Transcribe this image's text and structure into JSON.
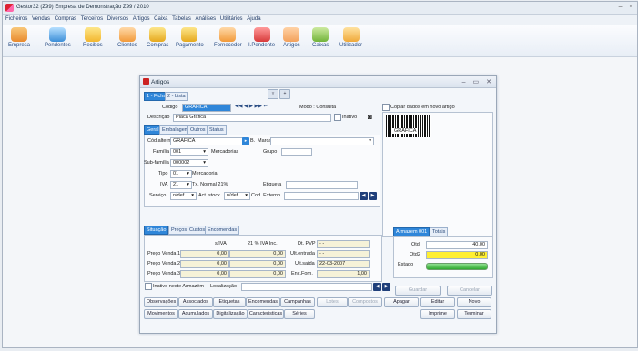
{
  "window": {
    "title": "Gestor32 (Z99) Empresa de Demonstração Z99 / 2010"
  },
  "menu": [
    "Ficheiros",
    "Vendas",
    "Compras",
    "Terceiros",
    "Diversos",
    "Artigos",
    "Caixa",
    "Tabelas",
    "Análises",
    "Utilitários",
    "Ajuda"
  ],
  "toolbar": [
    "Empresa",
    "Pendentes",
    "Recibos",
    "Clientes",
    "Compras",
    "Pagamento",
    "Fornecedor",
    "I.Pendente",
    "Artigos",
    "Caixas",
    "Utilizador"
  ],
  "dialog": {
    "title": "Artigos",
    "top_tabs": [
      "1 - Ficha",
      "2 - Lista"
    ],
    "codigo_label": "Código",
    "codigo": "GRÁFICA",
    "modo": "Modo : Consulta",
    "copiar": "Copiar dados em novo artigo",
    "descricao_label": "Descrição",
    "descricao": "Placa Gráfica",
    "inativo_label": "Inativo",
    "sub_tabs": [
      "Geral",
      "Embalagem",
      "Outros",
      "Status"
    ],
    "cod_altern_label": "Cód.altern",
    "cod_altern": "GRÁFICA",
    "marca_label": "Marca",
    "familia_label": "Família",
    "familia": "001",
    "familia_desc": "Mercadorias",
    "grupo_label": "Grupo",
    "subfamilia_label": "Sub-família",
    "subfamilia": "000002",
    "tipo_label": "Tipo",
    "tipo": "01",
    "tipo_desc": "Mercadoria",
    "iva_label": "IVA",
    "iva": "21",
    "iva_desc": "Tx. Normal 21%",
    "etiqueta_label": "Etiqueta",
    "servico_label": "Serviço",
    "servico": "n/def",
    "actstock_label": "Act. stock",
    "actstock": "n/def",
    "codexterno_label": "Cod. Externo",
    "barcode_text": "GRÁFICA",
    "bottom_tabs": [
      "Situação",
      "Preços",
      "Custos",
      "Encomendas"
    ],
    "col_siva": "s/IVA",
    "col_iva": "21 % IVA Inc.",
    "precos": [
      {
        "label": "Preço Venda 1",
        "siva": "0,00",
        "iva": "0,00"
      },
      {
        "label": "Preço Venda 2",
        "siva": "0,00",
        "iva": "0,00"
      },
      {
        "label": "Preço Venda 3",
        "siva": "0,00",
        "iva": "0,00"
      }
    ],
    "dtpvp_label": "Dt. PVP",
    "dtpvp": "- -",
    "ultentrada_label": "Ult.entrada",
    "ultentrada": "- -",
    "ultsaida_label": "Ult.saída",
    "ultsaida": "22-03-2007",
    "encforn_label": "Enc.Forn.",
    "encforn": "1,00",
    "inativo_armazem": "Inativo neste Armazém",
    "localizacao_label": "Localização",
    "armazem_tabs": [
      "Armazem 001",
      "Totais"
    ],
    "qtd_label": "Qtd",
    "qtd": "40,00",
    "qtd2_label": "Qtd2",
    "qtd2": "0,00",
    "estado_label": "Estado",
    "guardar": "Guardar",
    "cancelar": "Cancelar",
    "row1_buttons": [
      "Observações",
      "Associados",
      "Etiquetas",
      "Encomendas",
      "Campanhas",
      "Lotes",
      "Compostos",
      "Apagar",
      "Editar",
      "Novo"
    ],
    "row2_buttons": [
      "Movimentos",
      "Acumulados",
      "Digitalização",
      "Caracteristicas",
      "Séries",
      "Imprime",
      "Terminar"
    ]
  },
  "colors": {
    "accent": "#2f86d9",
    "yellow": "#ffef33",
    "green": "#3dbb3d"
  }
}
